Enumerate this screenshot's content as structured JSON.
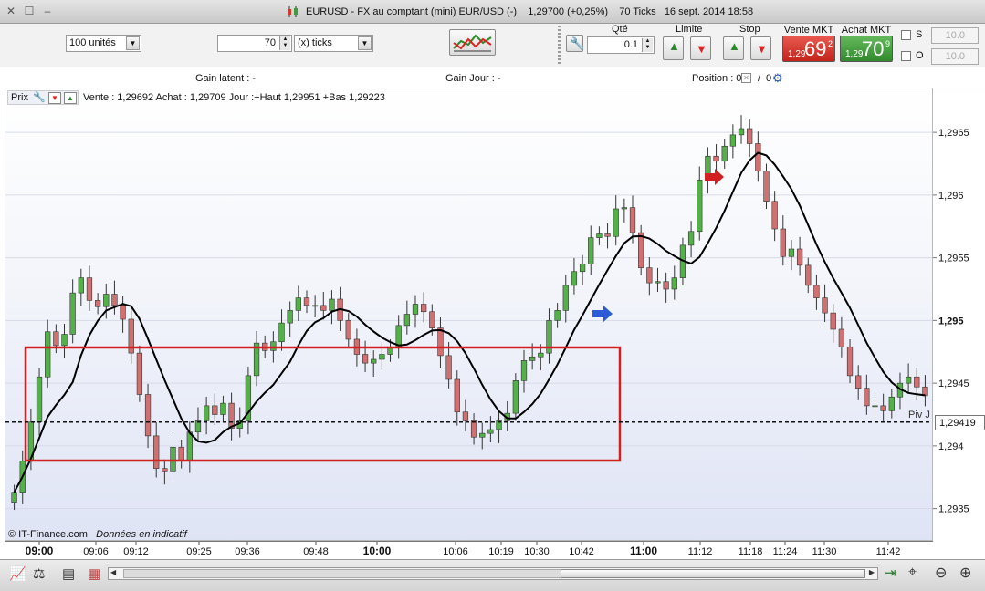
{
  "window": {
    "title": "EURUSD - FX au comptant (mini) EUR/USD (-)",
    "quote": "1,29700 (+0,25%)",
    "ticks": "70 Ticks",
    "datetime": "16 sept. 2014 18:58"
  },
  "toolbar": {
    "units_value": "100 unités",
    "period_value": "70",
    "period_unit": "(x) ticks",
    "qty_label": "Qté",
    "qty_value": "0.1",
    "limit_label": "Limite",
    "stop_label": "Stop",
    "sell": {
      "label": "Vente MKT",
      "small": "1,29",
      "big": "69",
      "sup": "2",
      "color": "#d9352b"
    },
    "buy": {
      "label": "Achat MKT",
      "small": "1,29",
      "big": "70",
      "sup": "9",
      "color": "#3f9c3a"
    },
    "s_label": "S",
    "s_value": "10.0",
    "o_label": "O",
    "o_value": "10.0"
  },
  "infobar": {
    "gain_latent": "Gain latent : -",
    "gain_jour": "Gain Jour : -",
    "position_label": "Position : 0",
    "position_sep": "/",
    "position_value": "0"
  },
  "chart_header": {
    "prix_label": "Prix",
    "info": "Vente : 1,29692 Achat : 1,29709 Jour :+Haut 1,29951 +Bas 1,29223"
  },
  "watermark": {
    "source": "© IT-Finance.com",
    "note": "Données en indicatif"
  },
  "chart_data": {
    "type": "candlestick",
    "y_ticks": [
      "1,2965",
      "1,296",
      "1,2955",
      "1,295",
      "1,2945",
      "1,294",
      "1,2935"
    ],
    "y_tick_values": [
      1.2965,
      1.296,
      1.2955,
      1.295,
      1.2945,
      1.294,
      1.2935
    ],
    "ylim": [
      1.29325,
      1.29685
    ],
    "x_ticks": [
      "09:00",
      "09:06",
      "09:12",
      "09:25",
      "09:36",
      "09:48",
      "10:00",
      "10:06",
      "10:19",
      "10:30",
      "10:42",
      "11:00",
      "11:12",
      "11:18",
      "11:24",
      "11:30",
      "11:42"
    ],
    "x_ticks_bold": [
      "09:00",
      "10:00",
      "11:00"
    ],
    "last_price_label": "1,29419",
    "last_price": 1.29419,
    "pivot_label": "Piv J",
    "bullish_color": "#55b04a",
    "bearish_color": "#d07070",
    "moving_average_color": "#000000",
    "box_color": "#d22020",
    "closes": [
      1.29363,
      1.29388,
      1.29419,
      1.29455,
      1.29491,
      1.2948,
      1.29489,
      1.29522,
      1.29534,
      1.29516,
      1.29511,
      1.29521,
      1.29512,
      1.29501,
      1.29474,
      1.29441,
      1.29408,
      1.29382,
      1.2938,
      1.29399,
      1.29388,
      1.29411,
      1.2942,
      1.29432,
      1.29425,
      1.29434,
      1.29414,
      1.2942,
      1.29456,
      1.29482,
      1.29476,
      1.29483,
      1.29498,
      1.29508,
      1.29518,
      1.29512,
      1.29512,
      1.29508,
      1.29517,
      1.295,
      1.29485,
      1.29473,
      1.29466,
      1.29469,
      1.29473,
      1.29479,
      1.29496,
      1.29505,
      1.29513,
      1.29507,
      1.29494,
      1.29472,
      1.29453,
      1.29427,
      1.2942,
      1.29407,
      1.2941,
      1.29413,
      1.2942,
      1.29426,
      1.29452,
      1.29468,
      1.29471,
      1.29474,
      1.295,
      1.29508,
      1.29528,
      1.29539,
      1.29545,
      1.29566,
      1.29569,
      1.29567,
      1.29589,
      1.2959,
      1.2957,
      1.29542,
      1.2953,
      1.29531,
      1.29525,
      1.29534,
      1.2956,
      1.29571,
      1.29612,
      1.29631,
      1.29627,
      1.29639,
      1.29648,
      1.29653,
      1.29641,
      1.29619,
      1.29595,
      1.29573,
      1.29551,
      1.29557,
      1.29544,
      1.29528,
      1.29518,
      1.29506,
      1.29493,
      1.29479,
      1.29456,
      1.29446,
      1.29432,
      1.29432,
      1.29428,
      1.29439,
      1.2945,
      1.29455,
      1.29447,
      1.2944
    ]
  },
  "statusbar": {
    "right_icons": [
      "crosshair-icon",
      "zoom-out-icon",
      "zoom-in-icon"
    ]
  }
}
